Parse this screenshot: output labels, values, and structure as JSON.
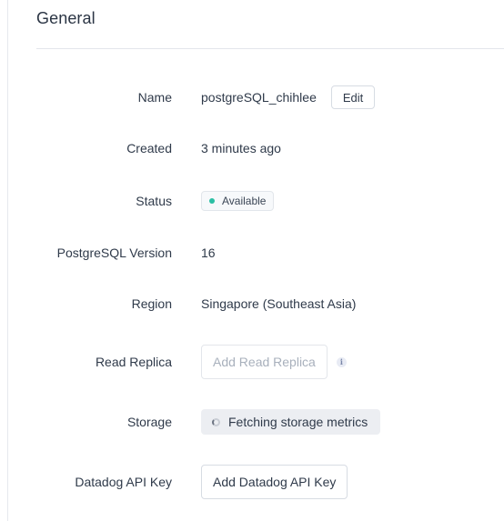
{
  "section": {
    "title": "General"
  },
  "fields": {
    "name": {
      "label": "Name",
      "value": "postgreSQL_chihlee",
      "edit_label": "Edit"
    },
    "created": {
      "label": "Created",
      "value": "3 minutes ago"
    },
    "status": {
      "label": "Status",
      "value": "Available",
      "dot_color": "#2bbfa4"
    },
    "version": {
      "label": "PostgreSQL Version",
      "value": "16"
    },
    "region": {
      "label": "Region",
      "value": "Singapore (Southeast Asia)"
    },
    "read_replica": {
      "label": "Read Replica",
      "button_label": "Add Read Replica",
      "info_icon": "i"
    },
    "storage": {
      "label": "Storage",
      "value": "Fetching storage metrics"
    },
    "datadog": {
      "label": "Datadog API Key",
      "button_label": "Add Datadog API Key"
    }
  }
}
